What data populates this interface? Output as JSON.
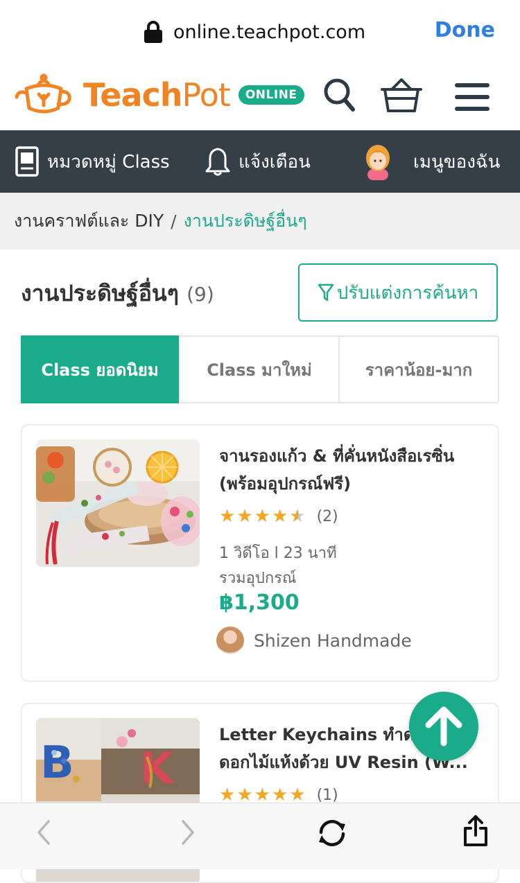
{
  "browser": {
    "url": "online.teachpot.com",
    "done_label": "Done"
  },
  "header": {
    "logo_teach": "Teach",
    "logo_pot": "Pot",
    "logo_badge": "ONLINE"
  },
  "nav": {
    "categories_label": "หมวดหมู่ Class",
    "notifications_label": "แจ้งเตือน",
    "my_menu_label": "เมนูของฉัน"
  },
  "breadcrumb": {
    "parent": "งานคราฟต์และ DIY",
    "separator": "/",
    "current": "งานประดิษฐ์อื่นๆ"
  },
  "page": {
    "title": "งานประดิษฐ์อื่นๆ",
    "count": "(9)",
    "filter_label": "ปรับแต่งการค้นหา"
  },
  "sort_tabs": [
    {
      "label": "Class ยอดนิยม",
      "active": true
    },
    {
      "label": "Class มาใหม่",
      "active": false
    },
    {
      "label": "ราคาน้อย-มาก",
      "active": false
    }
  ],
  "courses": [
    {
      "title": "จานรองแก้ว & ที่คั่นหนังสือเรซิ่น (พร้อมอุปกรณ์ฟรี)",
      "rating": 4.5,
      "rating_count": "(2)",
      "duration": "1 วิดีโอ l 23 นาที",
      "includes": "รวมอุปกรณ์",
      "price": "฿1,300",
      "instructor": "Shizen Handmade"
    },
    {
      "title": "Letter Keychains ทำด... ดอกไม้แห้งด้วย UV Resin (W...",
      "rating": 5,
      "rating_count": "(1)"
    }
  ],
  "colors": {
    "brand_orange": "#f08424",
    "brand_green": "#1aab8a",
    "nav_dark": "#343f47"
  },
  "icons": [
    "lock-icon",
    "search-icon",
    "basket-icon",
    "hamburger-menu-icon",
    "book-icon",
    "bell-icon",
    "user-avatar-icon",
    "filter-icon",
    "star-icon",
    "arrow-up-icon",
    "back-icon",
    "forward-icon",
    "refresh-icon",
    "share-icon"
  ]
}
